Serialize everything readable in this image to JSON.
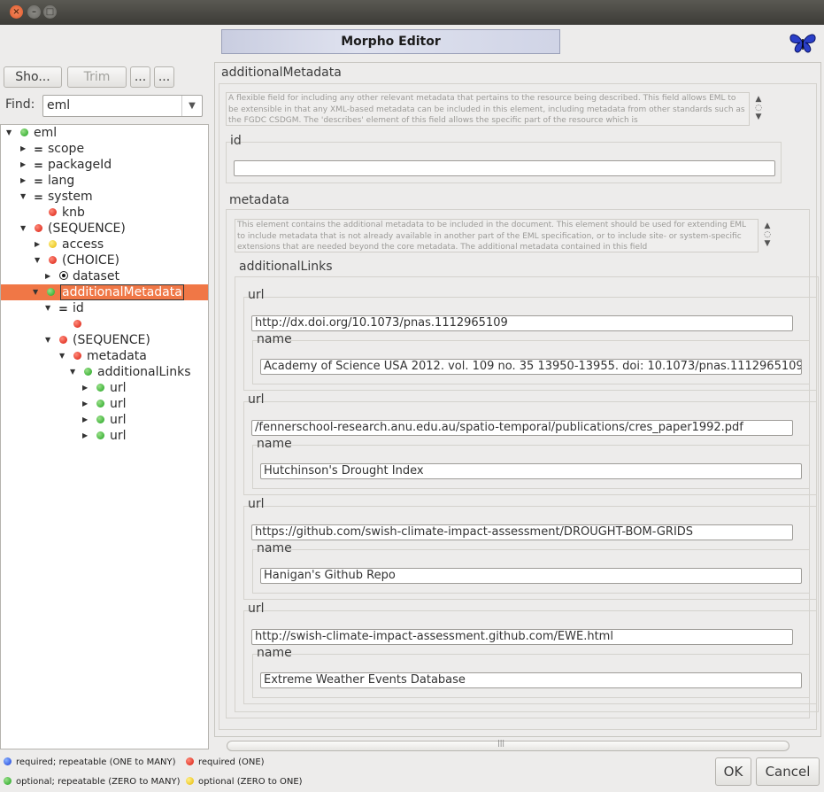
{
  "window": {
    "close_glyph": "×",
    "min_glyph": "–",
    "max_glyph": "□"
  },
  "header": {
    "title": "Morpho Editor",
    "logo_icon": "butterfly-icon"
  },
  "toolbar": {
    "show_label": "Sho...",
    "trim_label": "Trim",
    "more1_label": "...",
    "more2_label": "..."
  },
  "find": {
    "label": "Find:",
    "value": "eml"
  },
  "tree": [
    {
      "label": "eml",
      "marker": "green",
      "expander": "down"
    },
    {
      "label": "scope",
      "marker": "eq",
      "expander": "right"
    },
    {
      "label": "packageId",
      "marker": "eq",
      "expander": "right"
    },
    {
      "label": "lang",
      "marker": "eq",
      "expander": "right"
    },
    {
      "label": "system",
      "marker": "eq",
      "expander": "down"
    },
    {
      "label": "knb",
      "marker": "red",
      "expander": ""
    },
    {
      "label": "(SEQUENCE)",
      "marker": "red",
      "expander": "down"
    },
    {
      "label": "access",
      "marker": "yellow",
      "expander": "right"
    },
    {
      "label": "(CHOICE)",
      "marker": "red",
      "expander": "down"
    },
    {
      "label": "dataset",
      "marker": "radio",
      "expander": "right"
    },
    {
      "label": "additionalMetadata",
      "marker": "green",
      "expander": "down",
      "selected": true
    },
    {
      "label": "id",
      "marker": "eq",
      "expander": "down"
    },
    {
      "label": "",
      "marker": "red",
      "expander": ""
    },
    {
      "label": "(SEQUENCE)",
      "marker": "red",
      "expander": "down"
    },
    {
      "label": "metadata",
      "marker": "red",
      "expander": "down"
    },
    {
      "label": "additionalLinks",
      "marker": "green",
      "expander": "down"
    },
    {
      "label": "url",
      "marker": "green",
      "expander": "right"
    },
    {
      "label": "url",
      "marker": "green",
      "expander": "right"
    },
    {
      "label": "url",
      "marker": "green",
      "expander": "right"
    },
    {
      "label": "url",
      "marker": "green",
      "expander": "right"
    }
  ],
  "form": {
    "additional_metadata_label": "additionalMetadata",
    "additional_metadata_desc": "A flexible field for including any other relevant metadata that pertains to the resource being described. This field allows EML to be extensible in that any XML-based metadata can be included in this element, including metadata from other standards such as the FGDC CSDGM. The 'describes' element of this field allows the specific part of the resource which is",
    "id_label": "id",
    "id_value": "",
    "metadata_label": "metadata",
    "metadata_desc": "This element contains the additional metadata to be included in the document. This element should be used for extending EML to include metadata that is not already available in another part of the EML specification, or to include site- or system-specific extensions that are needed beyond the core metadata. The additional metadata contained in this field",
    "additional_links_label": "additionalLinks",
    "url_label": "url",
    "name_label": "name",
    "links": [
      {
        "url": "http://dx.doi.org/10.1073/pnas.1112965109",
        "name": "Academy of Science USA 2012. vol. 109 no. 35 13950-13955. doi: 10.1073/pnas.1112965109"
      },
      {
        "url": "/fennerschool-research.anu.edu.au/spatio-temporal/publications/cres_paper1992.pdf",
        "name": "Hutchinson's Drought Index"
      },
      {
        "url": "https://github.com/swish-climate-impact-assessment/DROUGHT-BOM-GRIDS",
        "name": "Hanigan's Github Repo"
      },
      {
        "url": "http://swish-climate-impact-assessment.github.com/EWE.html",
        "name": "Extreme Weather Events Database"
      }
    ]
  },
  "legend": {
    "required_repeatable": "required; repeatable (ONE to MANY)",
    "required": "required (ONE)",
    "optional_repeatable": "optional; repeatable (ZERO to MANY)",
    "optional": "optional (ZERO to ONE)"
  },
  "buttons": {
    "ok": "OK",
    "cancel": "Cancel"
  },
  "scroll_grip": "|||"
}
